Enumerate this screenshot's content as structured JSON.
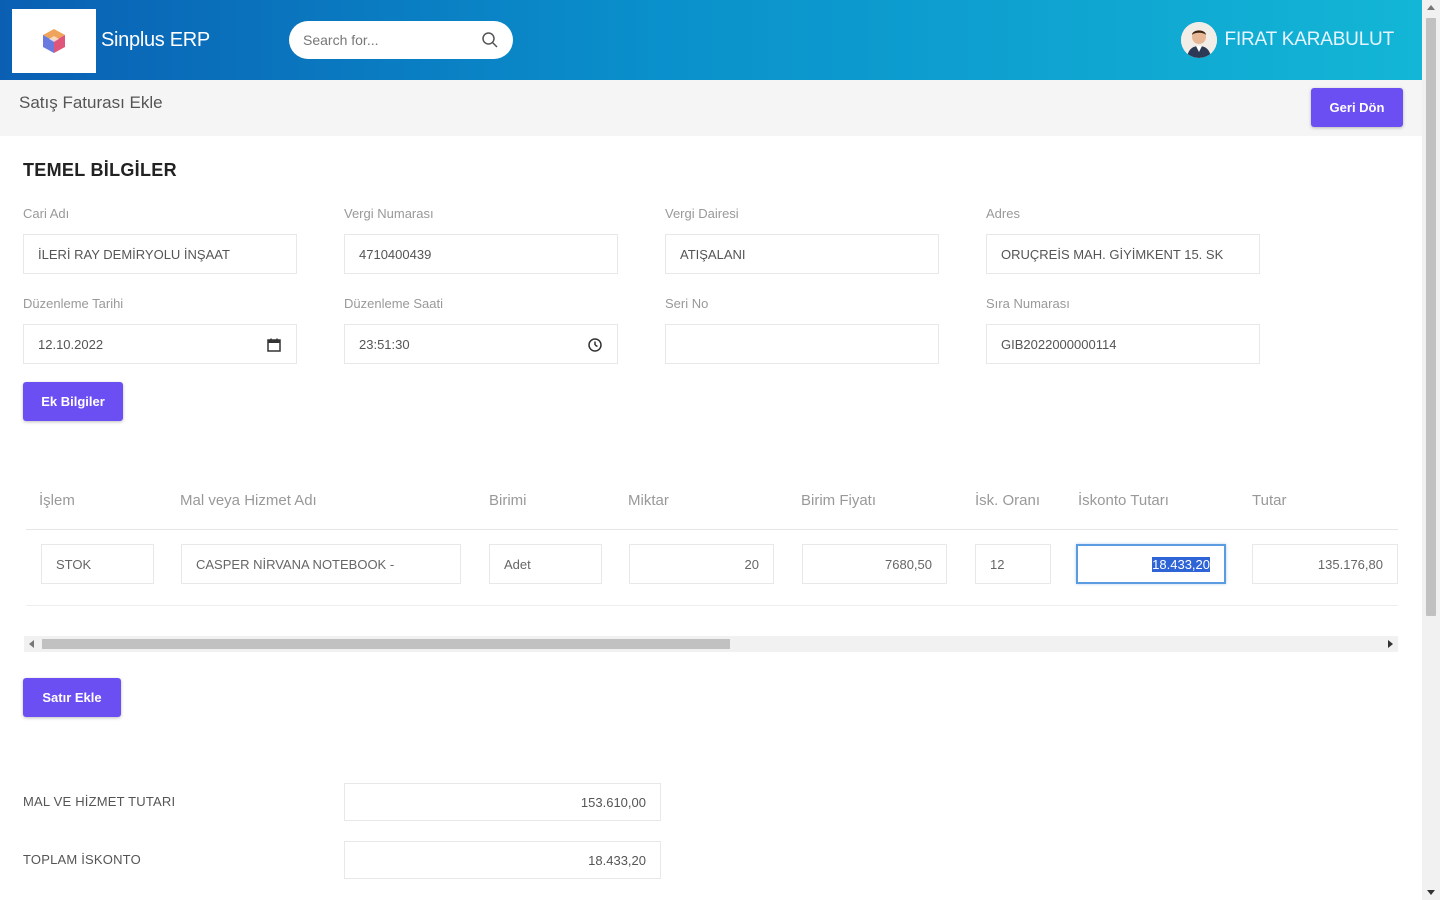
{
  "colors": {
    "header_start": "#0a5fb3",
    "header_end": "#13b6d6",
    "accent": "#6c4ff3",
    "active_border": "#5b9be0"
  },
  "app": {
    "name": "Sinplus ERP",
    "logo_icon": "cube-logo-icon"
  },
  "search": {
    "placeholder": "Search for...",
    "icon": "search-icon"
  },
  "user": {
    "name": "FIRAT KARABULUT",
    "avatar_icon": "user-avatar-icon"
  },
  "page": {
    "title": "Satış Faturası Ekle",
    "back_label": "Geri Dön"
  },
  "section": {
    "title": "TEMEL BİLGİLER",
    "fields": {
      "cari_adi": {
        "label": "Cari Adı",
        "value": "İLERİ RAY DEMİRYOLU İNŞAAT"
      },
      "vergi_no": {
        "label": "Vergi Numarası",
        "value": "4710400439"
      },
      "vergi_dairesi": {
        "label": "Vergi Dairesi",
        "value": "ATIŞALANI"
      },
      "adres": {
        "label": "Adres",
        "value": "ORUÇREİS MAH. GİYİMKENT 15. SK"
      },
      "duzenleme_tarihi": {
        "label": "Düzenleme Tarihi",
        "value": "12.10.2022",
        "icon": "calendar-icon"
      },
      "duzenleme_saati": {
        "label": "Düzenleme Saati",
        "value": "23:51:30",
        "icon": "clock-icon"
      },
      "seri_no": {
        "label": "Seri No",
        "value": ""
      },
      "sira_no": {
        "label": "Sıra Numarası",
        "value": "GIB2022000000114"
      }
    },
    "ek_bilgiler_label": "Ek Bilgiler"
  },
  "table": {
    "headers": [
      "İşlem",
      "Mal veya Hizmet Adı",
      "Birimi",
      "Miktar",
      "Birim Fiyatı",
      "İsk. Oranı",
      "İskonto Tutarı",
      "Tutar"
    ],
    "rows": [
      {
        "islem": "STOK",
        "urun": "CASPER NİRVANA NOTEBOOK -",
        "birim": "Adet",
        "miktar": "20",
        "birim_fiyat": "7680,50",
        "isk_orani": "12",
        "iskonto_tutari": "18.433,20",
        "tutar": "135.176,80"
      }
    ],
    "horizontal_scroll_position": 0.5
  },
  "satir_ekle_label": "Satır Ekle",
  "totals": {
    "mal_hizmet": {
      "label": "MAL VE HİZMET TUTARI",
      "value": "153.610,00"
    },
    "toplam_iskonto": {
      "label": "TOPLAM İSKONTO",
      "value": "18.433,20"
    }
  }
}
